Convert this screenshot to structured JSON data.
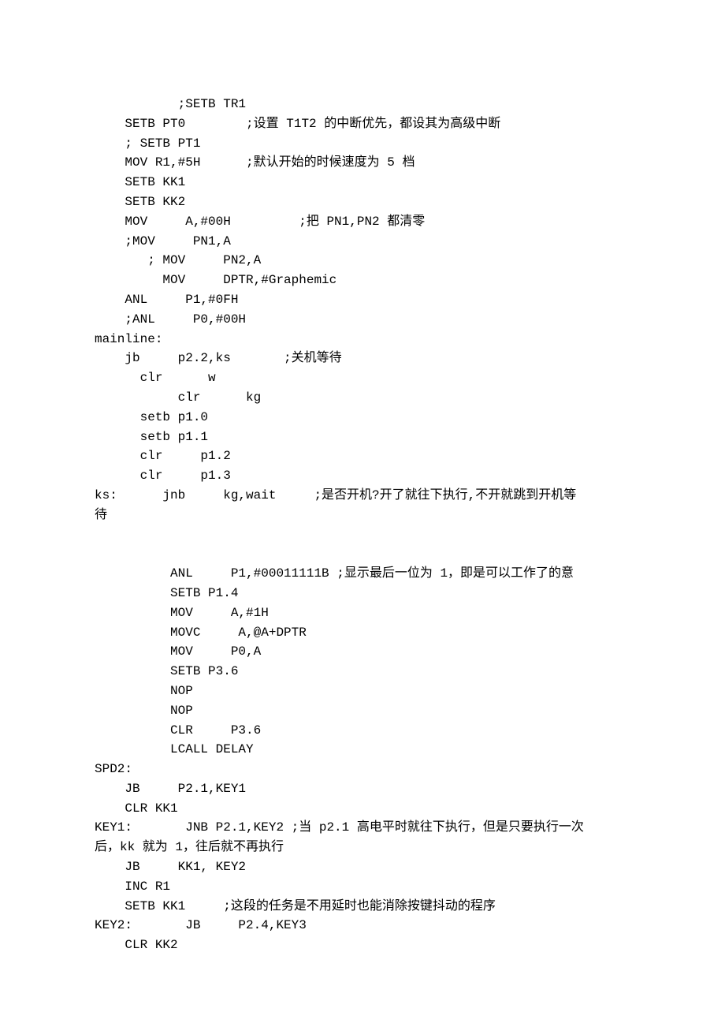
{
  "lines": [
    "           ;SETB TR1",
    "    SETB PT0        ;设置 T1T2 的中断优先，都设其为高级中断",
    "    ; SETB PT1",
    "    MOV R1,#5H      ;默认开始的时候速度为 5 档",
    "    SETB KK1",
    "    SETB KK2",
    "    MOV     A,#00H         ;把 PN1,PN2 都清零",
    "    ;MOV     PN1,A",
    "       ; MOV     PN2,A",
    "         MOV     DPTR,#Graphemic",
    "    ANL     P1,#0FH",
    "    ;ANL     P0,#00H",
    "mainline:",
    "    jb     p2.2,ks       ;关机等待",
    "      clr      w",
    "           clr      kg",
    "      setb p1.0",
    "      setb p1.1",
    "      clr     p1.2",
    "      clr     p1.3",
    "ks:      jnb     kg,wait     ;是否开机?开了就往下执行,不开就跳到开机等",
    "待",
    "",
    "",
    "          ANL     P1,#00011111B ;显示最后一位为 1，即是可以工作了的意",
    "          SETB P1.4",
    "          MOV     A,#1H",
    "          MOVC     A,@A+DPTR",
    "          MOV     P0,A",
    "          SETB P3.6",
    "          NOP",
    "          NOP",
    "          CLR     P3.6",
    "          LCALL DELAY",
    "SPD2:",
    "    JB     P2.1,KEY1",
    "    CLR KK1",
    "KEY1:       JNB P2.1,KEY2 ;当 p2.1 高电平时就往下执行，但是只要执行一次",
    "后，kk 就为 1，往后就不再执行",
    "    JB     KK1, KEY2",
    "    INC R1",
    "    SETB KK1     ;这段的任务是不用延时也能消除按键抖动的程序",
    "KEY2:       JB     P2.4,KEY3",
    "    CLR KK2"
  ]
}
